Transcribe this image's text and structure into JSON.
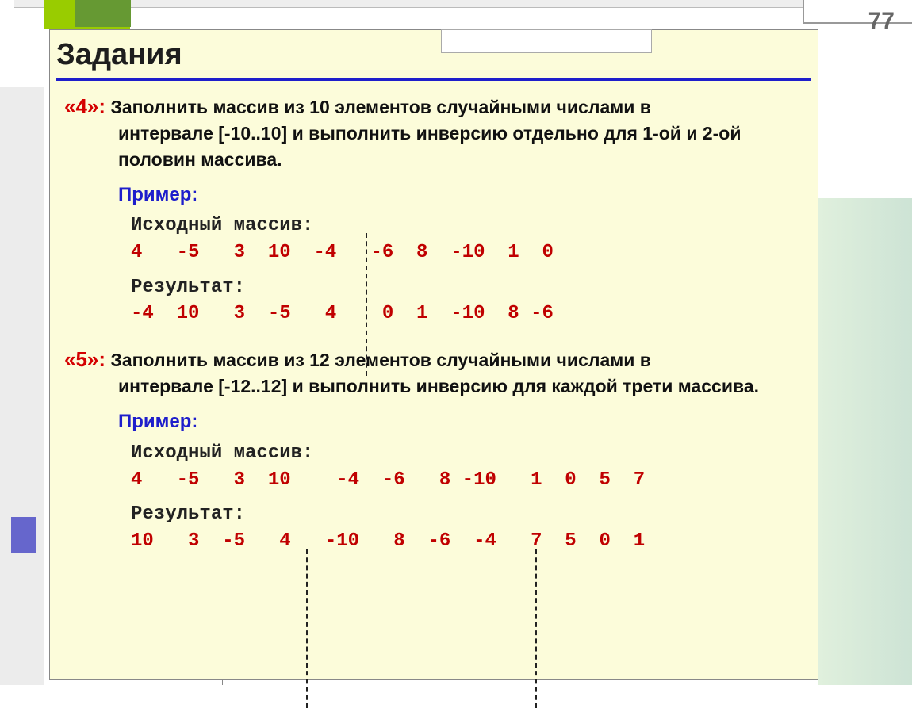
{
  "page_number": "77",
  "title": "Задания",
  "task4": {
    "label": "«4»:",
    "text_lead": "Заполнить массив из 10 элементов случайными числами в",
    "text_rest": "интервале [-10..10] и выполнить инверсию отдельно для 1-ой и 2-ой половин массива.",
    "example_label": "Пример:",
    "src_label": "Исходный массив:",
    "src_row": "4   -5   3  10  -4   -6  8  -10  1  0",
    "res_label": "Результат:",
    "res_row": "-4  10   3  -5   4    0  1  -10  8 -6"
  },
  "task5": {
    "label": "«5»:",
    "text_lead": "Заполнить массив из 12 элементов случайными числами в",
    "text_rest": "интервале [-12..12] и выполнить инверсию для каждой трети массива.",
    "example_label": "Пример:",
    "src_label": "Исходный массив:",
    "src_row": "4   -5   3  10    -4  -6   8 -10   1  0  5  7",
    "res_label": "Результат:",
    "res_row": "10   3  -5   4   -10   8  -6  -4   7  5  0  1"
  }
}
